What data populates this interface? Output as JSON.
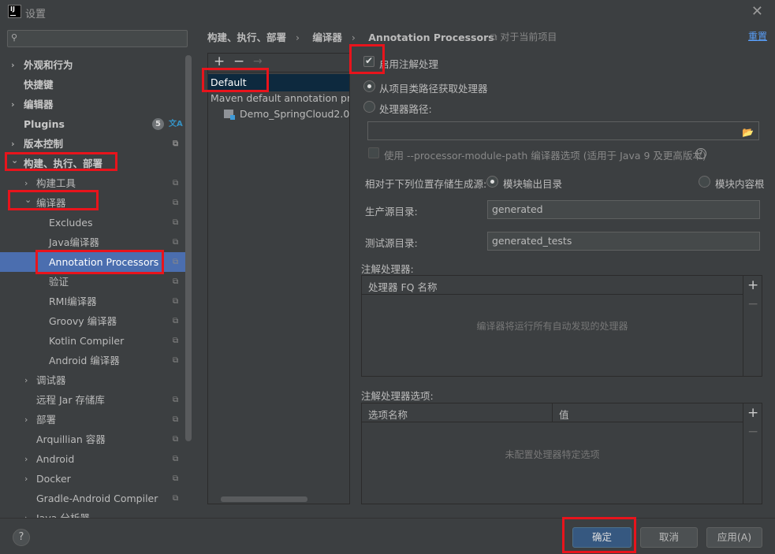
{
  "window": {
    "title": "设置",
    "close_glyph": "✕",
    "app_icon_text": "IJ"
  },
  "sidebar": {
    "search_placeholder": "",
    "items": [
      {
        "label": "外观和行为",
        "arrow": "›",
        "bold": true
      },
      {
        "label": "快捷键",
        "bold": true
      },
      {
        "label": "编辑器",
        "arrow": "›",
        "bold": true
      },
      {
        "label": "Plugins",
        "bold": true,
        "badge": "5"
      },
      {
        "label": "版本控制",
        "arrow": "›",
        "bold": true
      },
      {
        "label": "构建、执行、部署",
        "arrow": "⌄",
        "bold": true
      },
      {
        "label": "构建工具",
        "arrow": "›"
      },
      {
        "label": "编译器",
        "arrow": "⌄"
      },
      {
        "label": "Excludes"
      },
      {
        "label": "Java编译器"
      },
      {
        "label": "Annotation Processors"
      },
      {
        "label": "验证"
      },
      {
        "label": "RMI编译器"
      },
      {
        "label": "Groovy 编译器"
      },
      {
        "label": "Kotlin Compiler"
      },
      {
        "label": "Android 编译器"
      },
      {
        "label": "调试器",
        "arrow": "›"
      },
      {
        "label": "远程 Jar 存储库"
      },
      {
        "label": "部署",
        "arrow": "›"
      },
      {
        "label": "Arquillian 容器"
      },
      {
        "label": "Android",
        "arrow": "›"
      },
      {
        "label": "Docker",
        "arrow": "›"
      },
      {
        "label": "Gradle-Android Compiler"
      },
      {
        "label": "Java 分析器",
        "arrow": "›"
      }
    ]
  },
  "header": {
    "crumbs": [
      "构建、执行、部署",
      "编译器",
      "Annotation Processors"
    ],
    "separator": "›",
    "scope": "对于当前项目",
    "reset": "重置"
  },
  "profiles": {
    "add": "+",
    "remove": "−",
    "move": "→",
    "items": [
      "Default",
      "Maven default annotation processors profile",
      "Demo_SpringCloud2.0"
    ]
  },
  "form": {
    "enable_label": "启用注解处理",
    "from_classpath": "从项目类路径获取处理器",
    "processor_path": "处理器路径:",
    "processor_path_value": "",
    "module_path_option": "使用 --processor-module-path 编译器选项 (适用于 Java 9 及更高版本)",
    "store_label": "相对于下列位置存储生成源:",
    "module_output": "模块输出目录",
    "module_content_root": "模块内容根",
    "prod_dir_label": "生产源目录:",
    "prod_dir_value": "generated",
    "test_dir_label": "测试源目录:",
    "test_dir_value": "generated_tests",
    "processors_label": "注解处理器:",
    "processors_column": "处理器 FQ 名称",
    "processors_empty": "编译器将运行所有自动发现的处理器",
    "options_label": "注解处理器选项:",
    "options_col_name": "选项名称",
    "options_col_value": "值",
    "options_empty": "未配置处理器特定选项",
    "add": "+",
    "remove": "−"
  },
  "footer": {
    "help": "?",
    "ok": "确定",
    "cancel": "取消",
    "apply": "应用(A)"
  }
}
